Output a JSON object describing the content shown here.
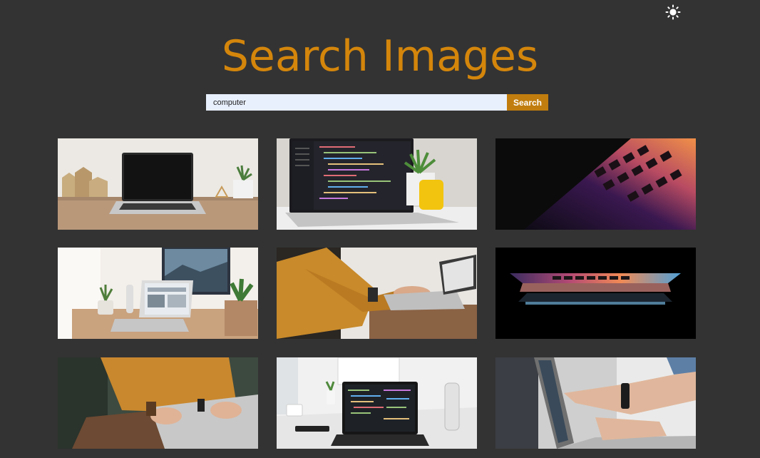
{
  "header": {
    "theme_icon": "sun-icon",
    "title": "Search Images"
  },
  "search": {
    "value": "computer",
    "button_label": "Search"
  },
  "results": [
    {
      "icon": "laptop-desk-photo"
    },
    {
      "icon": "code-laptop-photo"
    },
    {
      "icon": "keyboard-glow-photo"
    },
    {
      "icon": "workspace-monitor-photo"
    },
    {
      "icon": "typing-laptop-photo"
    },
    {
      "icon": "laptop-dark-glow-photo"
    },
    {
      "icon": "hands-laptop-photo"
    },
    {
      "icon": "code-desk-photo"
    },
    {
      "icon": "pointing-screen-photo"
    }
  ]
}
